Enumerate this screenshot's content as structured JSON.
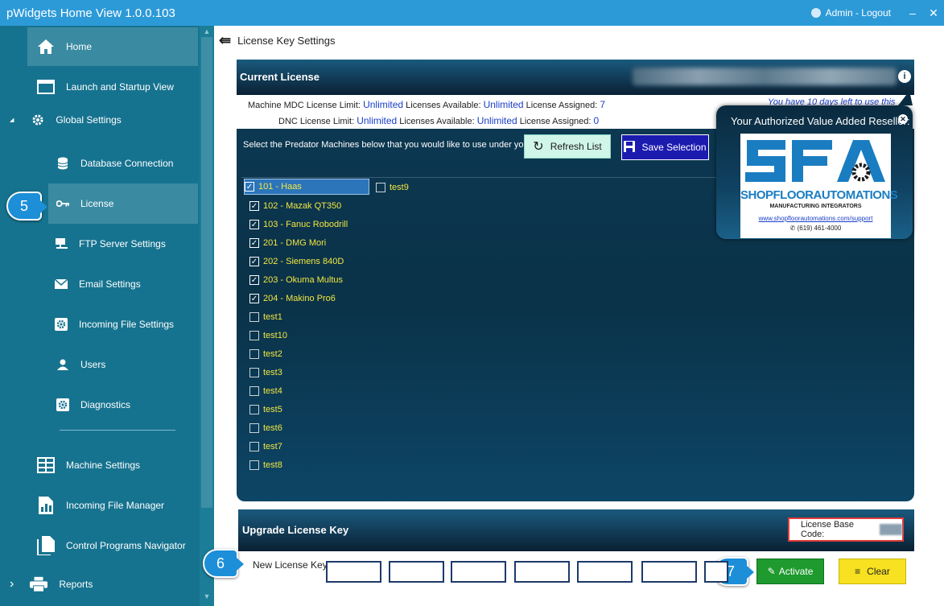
{
  "window": {
    "title": "pWidgets Home View 1.0.0.103",
    "user_text": "Admin - Logout",
    "minimize": "–",
    "close": "✕"
  },
  "sidebar": {
    "items": [
      {
        "label": "Home",
        "icon": "home-icon"
      },
      {
        "label": "Launch and Startup View",
        "icon": "window-icon"
      },
      {
        "label": "Global Settings",
        "icon": "gear-icon",
        "expander": "◢"
      },
      {
        "label": "Database Connection",
        "icon": "database-icon"
      },
      {
        "label": "License",
        "icon": "key-icon"
      },
      {
        "label": "FTP Server Settings",
        "icon": "network-icon"
      },
      {
        "label": "Email Settings",
        "icon": "envelope-icon"
      },
      {
        "label": "Incoming File Settings",
        "icon": "gear-box-icon"
      },
      {
        "label": "Users",
        "icon": "user-icon"
      },
      {
        "label": "Diagnostics",
        "icon": "gear-box-icon"
      },
      {
        "label": "Machine Settings",
        "icon": "grid-icon"
      },
      {
        "label": "Incoming File Manager",
        "icon": "chart-file-icon"
      },
      {
        "label": "Control Programs Navigator",
        "icon": "files-icon"
      },
      {
        "label": "Reports",
        "icon": "printer-icon",
        "expander": "›"
      }
    ]
  },
  "steps": {
    "s5": "5",
    "s6": "6",
    "s7": "7"
  },
  "page": {
    "title": "License Key Settings"
  },
  "current_license": {
    "heading": "Current License",
    "days_left": "You have 10 days left to use this",
    "mdc": {
      "label": "Machine MDC License Limit:",
      "limit": "Unlimited",
      "avail_label": "Licenses Available:",
      "avail": "Unlimited",
      "assigned_label": "License Assigned:",
      "assigned": "7"
    },
    "dnc": {
      "label": "DNC License Limit:",
      "limit": "Unlimited",
      "avail_label": "Licenses Available:",
      "avail": "Unlimited",
      "assigned_label": "License Assigned:",
      "assigned": "0"
    },
    "select_text": "Select the Predator Machines below that you would like to use under your license",
    "refresh_label": "Refresh List",
    "save_label": "Save Selection"
  },
  "machines": [
    {
      "name": "101 - Haas",
      "checked": true
    },
    {
      "name": "102 - Mazak QT350",
      "checked": true
    },
    {
      "name": "103 - Fanuc Robodrill",
      "checked": true
    },
    {
      "name": "201 - DMG Mori",
      "checked": true
    },
    {
      "name": "202 - Siemens 840D",
      "checked": true
    },
    {
      "name": "203 - Okuma Multus",
      "checked": true
    },
    {
      "name": "204 - Makino Pro6",
      "checked": true
    },
    {
      "name": "test1",
      "checked": false
    },
    {
      "name": "test10",
      "checked": false
    },
    {
      "name": "test2",
      "checked": false
    },
    {
      "name": "test3",
      "checked": false
    },
    {
      "name": "test4",
      "checked": false
    },
    {
      "name": "test5",
      "checked": false
    },
    {
      "name": "test6",
      "checked": false
    },
    {
      "name": "test7",
      "checked": false
    },
    {
      "name": "test8",
      "checked": false
    },
    {
      "name": "test9",
      "checked": false
    }
  ],
  "reseller": {
    "title": "Your Authorized Value Added Reseller:",
    "logo_main": "SHOPFLOORAUTOMATIONS",
    "logo_sub": "MANUFACTURING INTEGRATORS",
    "link": "www.shopfloorautomations.com/support",
    "phone": "(619) 461-4000"
  },
  "upgrade": {
    "heading": "Upgrade License Key",
    "base_code_label": "License Base Code:",
    "new_key_label": "New License Key",
    "activate_label": "Activate",
    "clear_label": "Clear"
  },
  "colors": {
    "titlebar": "#2d9ad8",
    "sidebar": "#16738f",
    "machine_text": "#f2e640",
    "value_blue": "#1a3ec8",
    "activate": "#1e9a2e",
    "clear": "#f7e120"
  }
}
